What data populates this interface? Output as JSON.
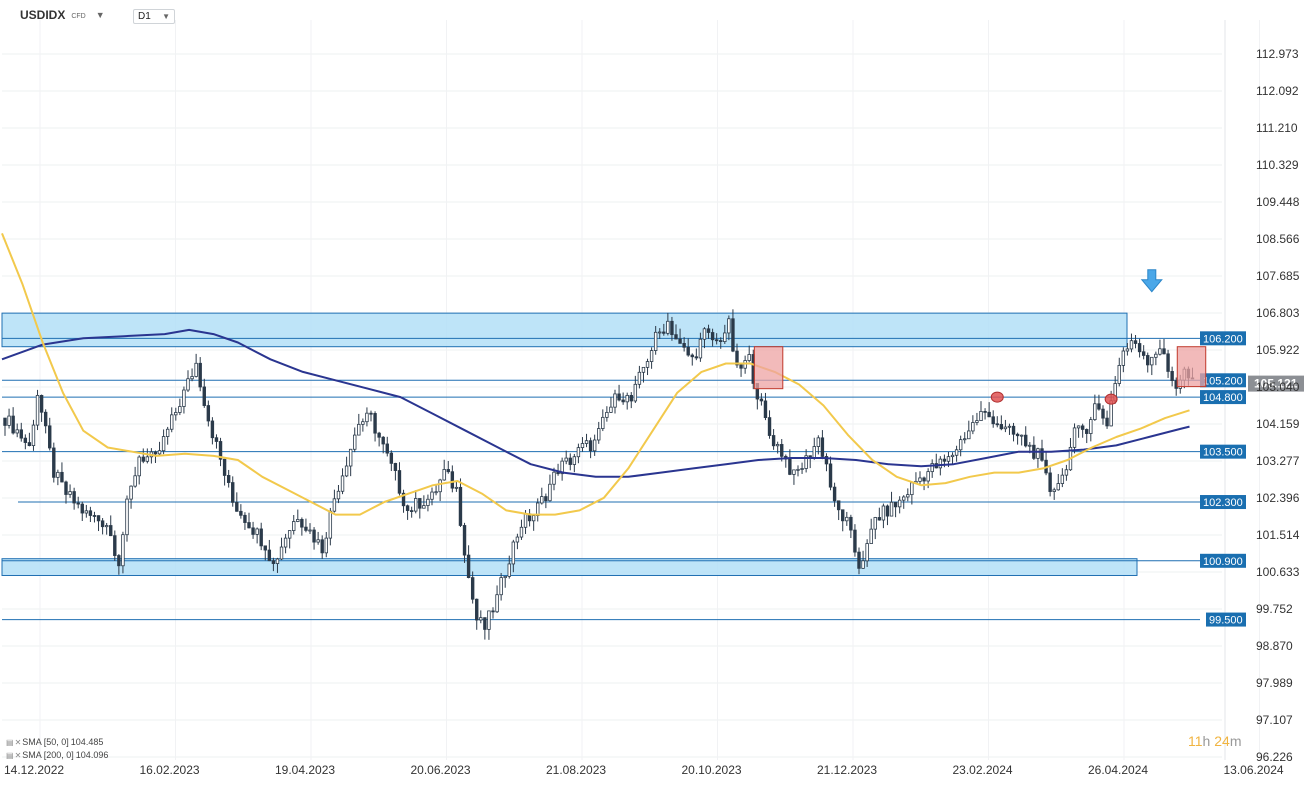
{
  "header": {
    "symbol": "USDIDX",
    "type": "CFD",
    "timeframe": "D1"
  },
  "legend": [
    {
      "label": "SMA [50, 0]",
      "value": "104.485"
    },
    {
      "label": "SMA [200, 0]",
      "value": "104.096"
    }
  ],
  "timer": {
    "hours": "11",
    "hours_unit": "h",
    "minutes": "24",
    "minutes_unit": "m"
  },
  "colors": {
    "candle": "#2b3a4a",
    "sma50": "#f2c94c",
    "sma200": "#2a3590",
    "level_line": "#1f6fb2",
    "zone_fill": "#b3dff7",
    "zone_border": "#1f6fb2",
    "red_box_fill": "#eda3a3",
    "red_box_border": "#c0392b",
    "price_tag": "#8c8f94",
    "level_tag": "#1a6fb0",
    "arrow": "#4aa7e8"
  },
  "chart_data": {
    "type": "candlestick",
    "symbol": "USDIDX",
    "timeframe": "D1",
    "x_tick_labels": [
      "14.12.2022",
      "16.02.2023",
      "19.04.2023",
      "20.06.2023",
      "21.08.2023",
      "20.10.2023",
      "21.12.2023",
      "23.02.2024",
      "26.04.2024",
      "13.06.2024"
    ],
    "y_tick_labels": [
      "112.973",
      "112.092",
      "111.210",
      "110.329",
      "109.448",
      "108.566",
      "107.685",
      "106.803",
      "105.922",
      "105.040",
      "104.159",
      "103.277",
      "102.396",
      "101.514",
      "100.633",
      "99.752",
      "98.870",
      "97.989",
      "97.107",
      "96.226"
    ],
    "ylim": [
      96.226,
      112.973
    ],
    "grid": true,
    "current_price": "105.121",
    "levels": [
      "106.200",
      "105.200",
      "104.800",
      "103.500",
      "102.300",
      "100.900",
      "99.500"
    ],
    "zones": [
      {
        "from": 106.0,
        "to": 106.8
      },
      {
        "from": 100.55,
        "to": 100.95
      }
    ],
    "close_path": [
      {
        "t": 0,
        "v": 104.3
      },
      {
        "t": 3,
        "v": 104.0
      },
      {
        "t": 6,
        "v": 103.6
      },
      {
        "t": 8,
        "v": 104.9
      },
      {
        "t": 12,
        "v": 103.0
      },
      {
        "t": 15,
        "v": 102.5
      },
      {
        "t": 20,
        "v": 102.0
      },
      {
        "t": 25,
        "v": 101.8
      },
      {
        "t": 28,
        "v": 100.9
      },
      {
        "t": 30,
        "v": 102.2
      },
      {
        "t": 33,
        "v": 103.4
      },
      {
        "t": 37,
        "v": 103.3
      },
      {
        "t": 40,
        "v": 104.0
      },
      {
        "t": 44,
        "v": 104.9
      },
      {
        "t": 47,
        "v": 105.6
      },
      {
        "t": 50,
        "v": 104.3
      },
      {
        "t": 53,
        "v": 103.3
      },
      {
        "t": 56,
        "v": 102.3
      },
      {
        "t": 60,
        "v": 101.8
      },
      {
        "t": 64,
        "v": 101.3
      },
      {
        "t": 66,
        "v": 100.8
      },
      {
        "t": 69,
        "v": 101.5
      },
      {
        "t": 72,
        "v": 102.0
      },
      {
        "t": 75,
        "v": 101.6
      },
      {
        "t": 78,
        "v": 101.2
      },
      {
        "t": 81,
        "v": 102.4
      },
      {
        "t": 84,
        "v": 103.3
      },
      {
        "t": 87,
        "v": 104.2
      },
      {
        "t": 90,
        "v": 104.3
      },
      {
        "t": 93,
        "v": 103.6
      },
      {
        "t": 96,
        "v": 102.9
      },
      {
        "t": 99,
        "v": 102.1
      },
      {
        "t": 102,
        "v": 102.3
      },
      {
        "t": 105,
        "v": 102.4
      },
      {
        "t": 108,
        "v": 103.0
      },
      {
        "t": 111,
        "v": 102.6
      },
      {
        "t": 114,
        "v": 100.5
      },
      {
        "t": 116,
        "v": 99.5
      },
      {
        "t": 118,
        "v": 99.3
      },
      {
        "t": 121,
        "v": 100.0
      },
      {
        "t": 124,
        "v": 101.0
      },
      {
        "t": 127,
        "v": 101.8
      },
      {
        "t": 130,
        "v": 102.0
      },
      {
        "t": 133,
        "v": 102.5
      },
      {
        "t": 136,
        "v": 103.1
      },
      {
        "t": 139,
        "v": 103.3
      },
      {
        "t": 142,
        "v": 103.6
      },
      {
        "t": 145,
        "v": 103.7
      },
      {
        "t": 148,
        "v": 104.4
      },
      {
        "t": 151,
        "v": 104.9
      },
      {
        "t": 154,
        "v": 104.7
      },
      {
        "t": 157,
        "v": 105.5
      },
      {
        "t": 160,
        "v": 106.2
      },
      {
        "t": 163,
        "v": 106.6
      },
      {
        "t": 166,
        "v": 106.0
      },
      {
        "t": 169,
        "v": 105.7
      },
      {
        "t": 172,
        "v": 106.3
      },
      {
        "t": 175,
        "v": 106.1
      },
      {
        "t": 178,
        "v": 106.5
      },
      {
        "t": 180,
        "v": 105.4
      },
      {
        "t": 183,
        "v": 105.7
      },
      {
        "t": 185,
        "v": 104.9
      },
      {
        "t": 188,
        "v": 103.9
      },
      {
        "t": 191,
        "v": 103.5
      },
      {
        "t": 194,
        "v": 102.9
      },
      {
        "t": 197,
        "v": 103.3
      },
      {
        "t": 200,
        "v": 103.8
      },
      {
        "t": 202,
        "v": 103.2
      },
      {
        "t": 204,
        "v": 102.2
      },
      {
        "t": 207,
        "v": 101.8
      },
      {
        "t": 210,
        "v": 100.8
      },
      {
        "t": 212,
        "v": 101.2
      },
      {
        "t": 214,
        "v": 101.9
      },
      {
        "t": 217,
        "v": 102.1
      },
      {
        "t": 220,
        "v": 102.3
      },
      {
        "t": 224,
        "v": 102.8
      },
      {
        "t": 228,
        "v": 103.1
      },
      {
        "t": 232,
        "v": 103.3
      },
      {
        "t": 236,
        "v": 103.9
      },
      {
        "t": 240,
        "v": 104.4
      },
      {
        "t": 243,
        "v": 104.3
      },
      {
        "t": 246,
        "v": 104.0
      },
      {
        "t": 250,
        "v": 103.8
      },
      {
        "t": 254,
        "v": 103.4
      },
      {
        "t": 257,
        "v": 102.6
      },
      {
        "t": 260,
        "v": 102.9
      },
      {
        "t": 263,
        "v": 103.9
      },
      {
        "t": 266,
        "v": 104.1
      },
      {
        "t": 268,
        "v": 104.6
      },
      {
        "t": 271,
        "v": 104.2
      },
      {
        "t": 273,
        "v": 105.2
      },
      {
        "t": 275,
        "v": 105.9
      },
      {
        "t": 278,
        "v": 106.1
      },
      {
        "t": 281,
        "v": 105.7
      },
      {
        "t": 284,
        "v": 106.0
      },
      {
        "t": 286,
        "v": 105.4
      },
      {
        "t": 288,
        "v": 105.1
      },
      {
        "t": 290,
        "v": 105.4
      },
      {
        "t": 292,
        "v": 105.1
      }
    ],
    "sma50": [
      {
        "t": 0,
        "v": 108.7
      },
      {
        "t": 5,
        "v": 107.5
      },
      {
        "t": 10,
        "v": 106.1
      },
      {
        "t": 15,
        "v": 104.9
      },
      {
        "t": 20,
        "v": 104.0
      },
      {
        "t": 26,
        "v": 103.6
      },
      {
        "t": 32,
        "v": 103.5
      },
      {
        "t": 38,
        "v": 103.4
      },
      {
        "t": 45,
        "v": 103.45
      },
      {
        "t": 52,
        "v": 103.4
      },
      {
        "t": 58,
        "v": 103.3
      },
      {
        "t": 64,
        "v": 102.9
      },
      {
        "t": 70,
        "v": 102.6
      },
      {
        "t": 76,
        "v": 102.3
      },
      {
        "t": 82,
        "v": 102.0
      },
      {
        "t": 88,
        "v": 102.0
      },
      {
        "t": 94,
        "v": 102.3
      },
      {
        "t": 100,
        "v": 102.5
      },
      {
        "t": 106,
        "v": 102.7
      },
      {
        "t": 112,
        "v": 102.8
      },
      {
        "t": 118,
        "v": 102.5
      },
      {
        "t": 124,
        "v": 102.1
      },
      {
        "t": 130,
        "v": 102.0
      },
      {
        "t": 136,
        "v": 102.0
      },
      {
        "t": 142,
        "v": 102.1
      },
      {
        "t": 148,
        "v": 102.4
      },
      {
        "t": 154,
        "v": 103.1
      },
      {
        "t": 160,
        "v": 104.0
      },
      {
        "t": 166,
        "v": 104.9
      },
      {
        "t": 172,
        "v": 105.4
      },
      {
        "t": 178,
        "v": 105.6
      },
      {
        "t": 184,
        "v": 105.6
      },
      {
        "t": 190,
        "v": 105.4
      },
      {
        "t": 196,
        "v": 105.1
      },
      {
        "t": 202,
        "v": 104.6
      },
      {
        "t": 208,
        "v": 103.9
      },
      {
        "t": 214,
        "v": 103.3
      },
      {
        "t": 220,
        "v": 102.9
      },
      {
        "t": 226,
        "v": 102.7
      },
      {
        "t": 232,
        "v": 102.75
      },
      {
        "t": 238,
        "v": 102.9
      },
      {
        "t": 244,
        "v": 103.0
      },
      {
        "t": 250,
        "v": 103.0
      },
      {
        "t": 256,
        "v": 103.1
      },
      {
        "t": 262,
        "v": 103.3
      },
      {
        "t": 268,
        "v": 103.6
      },
      {
        "t": 274,
        "v": 103.85
      },
      {
        "t": 280,
        "v": 104.05
      },
      {
        "t": 286,
        "v": 104.3
      },
      {
        "t": 292,
        "v": 104.485
      }
    ],
    "sma200": [
      {
        "t": 0,
        "v": 105.7
      },
      {
        "t": 10,
        "v": 106.05
      },
      {
        "t": 20,
        "v": 106.2
      },
      {
        "t": 30,
        "v": 106.25
      },
      {
        "t": 40,
        "v": 106.3
      },
      {
        "t": 46,
        "v": 106.4
      },
      {
        "t": 52,
        "v": 106.3
      },
      {
        "t": 58,
        "v": 106.1
      },
      {
        "t": 66,
        "v": 105.7
      },
      {
        "t": 74,
        "v": 105.4
      },
      {
        "t": 82,
        "v": 105.2
      },
      {
        "t": 90,
        "v": 105.0
      },
      {
        "t": 98,
        "v": 104.8
      },
      {
        "t": 106,
        "v": 104.4
      },
      {
        "t": 114,
        "v": 104.0
      },
      {
        "t": 122,
        "v": 103.6
      },
      {
        "t": 130,
        "v": 103.2
      },
      {
        "t": 138,
        "v": 103.0
      },
      {
        "t": 146,
        "v": 102.9
      },
      {
        "t": 154,
        "v": 102.9
      },
      {
        "t": 162,
        "v": 103.0
      },
      {
        "t": 170,
        "v": 103.1
      },
      {
        "t": 178,
        "v": 103.2
      },
      {
        "t": 186,
        "v": 103.3
      },
      {
        "t": 194,
        "v": 103.35
      },
      {
        "t": 202,
        "v": 103.35
      },
      {
        "t": 210,
        "v": 103.3
      },
      {
        "t": 218,
        "v": 103.2
      },
      {
        "t": 226,
        "v": 103.15
      },
      {
        "t": 234,
        "v": 103.2
      },
      {
        "t": 242,
        "v": 103.35
      },
      {
        "t": 250,
        "v": 103.5
      },
      {
        "t": 258,
        "v": 103.5
      },
      {
        "t": 266,
        "v": 103.55
      },
      {
        "t": 274,
        "v": 103.65
      },
      {
        "t": 282,
        "v": 103.85
      },
      {
        "t": 290,
        "v": 104.05
      },
      {
        "t": 292,
        "v": 104.096
      }
    ],
    "highlight_boxes": [
      {
        "t_from": 185,
        "t_to": 192,
        "v_from": 105.0,
        "v_to": 106.0
      },
      {
        "t_from": 289,
        "t_to": 296,
        "v_from": 105.05,
        "v_to": 106.0
      }
    ],
    "markers": [
      {
        "t": 244,
        "v": 104.8
      },
      {
        "t": 272,
        "v": 104.75
      }
    ],
    "arrow_down": {
      "t": 282,
      "v": 107.5
    }
  }
}
